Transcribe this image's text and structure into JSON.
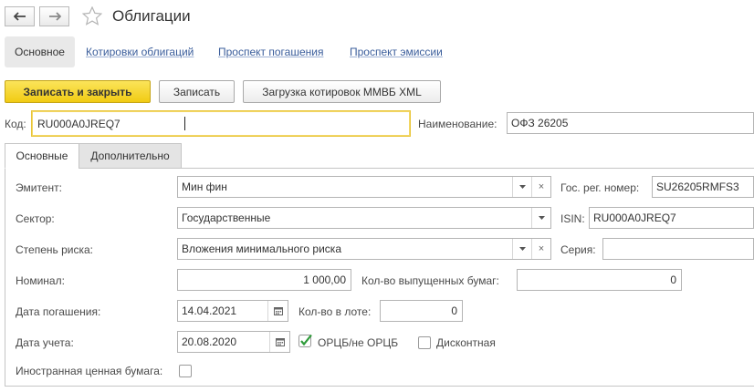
{
  "window": {
    "title": "Облигации"
  },
  "sections": {
    "main": "Основное",
    "links": [
      "Котировки облигаций",
      "Проспект погашения",
      "Проспект эмиссии"
    ]
  },
  "toolbar": {
    "save_close": "Записать и закрыть",
    "save": "Записать",
    "load_quotes": "Загрузка котировок ММВБ XML"
  },
  "header": {
    "code_label": "Код:",
    "code_value": "RU000A0JREQ7",
    "name_label": "Наименование:",
    "name_value": "ОФЗ 26205"
  },
  "tabs": [
    "Основные",
    "Дополнительно"
  ],
  "form": {
    "issuer_label": "Эмитент:",
    "issuer_value": "Мин фин",
    "reg_label": "Гос. рег. номер:",
    "reg_value": "SU26205RMFS3",
    "sector_label": "Сектор:",
    "sector_value": "Государственные",
    "isin_label": "ISIN:",
    "isin_value": "RU000A0JREQ7",
    "risk_label": "Степень риска:",
    "risk_value": "Вложения минимального риска",
    "series_label": "Серия:",
    "series_value": "",
    "nominal_label": "Номинал:",
    "nominal_value": "1 000,00",
    "issued_label": "Кол-во выпущенных бумаг:",
    "issued_value": "0",
    "maturity_label": "Дата погашения:",
    "maturity_value": "14.04.2021",
    "lot_label": "Кол-во в лоте:",
    "lot_value": "0",
    "account_date_label": "Дата учета:",
    "account_date_value": "20.08.2020",
    "orcb_label": "ОРЦБ/не ОРЦБ",
    "orcb_checked": true,
    "discount_label": "Дисконтная",
    "discount_checked": false,
    "foreign_label": "Иностранная ценная бумага:",
    "foreign_checked": false
  },
  "colors": {
    "accent": "#f1cb13",
    "link": "#3a5d9b",
    "check": "#2e9b3a"
  }
}
